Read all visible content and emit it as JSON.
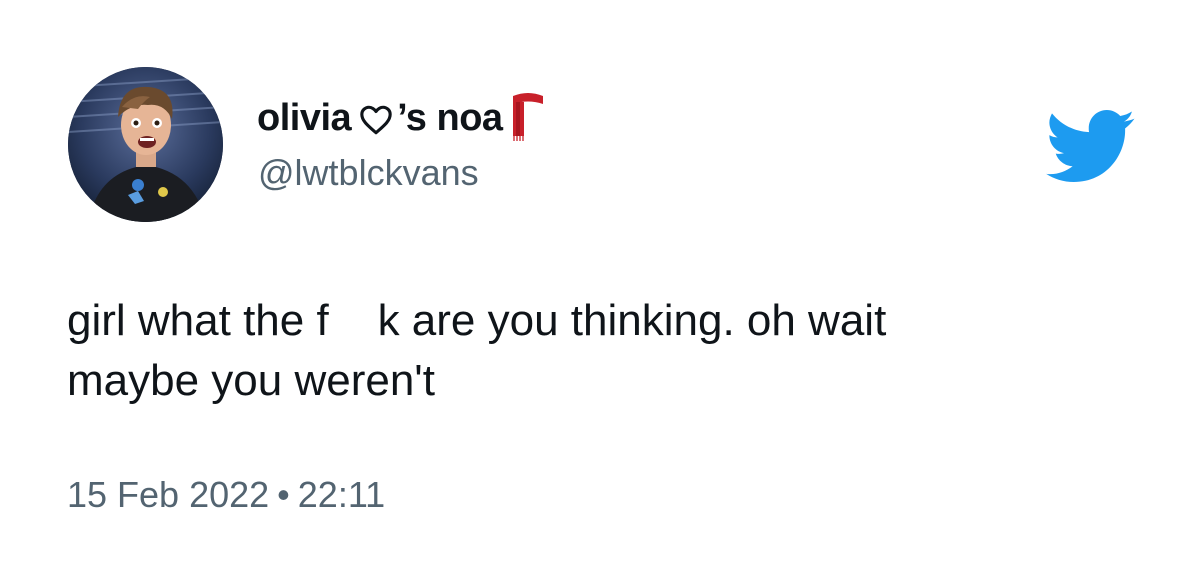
{
  "tweet": {
    "author": {
      "display_name_part1": "olivia",
      "display_name_part2": "’s noa",
      "heart_icon": "heart-outline-icon",
      "scarf_icon": "red-scarf-emoji",
      "handle": "@lwtblckvans",
      "avatar": "profile-photo"
    },
    "brand_icon": "twitter-bird-icon",
    "text": {
      "line1": "girl what the f    k are you thinking. oh wait",
      "line2": "maybe you weren't"
    },
    "timestamp": {
      "date": "15 Feb 2022",
      "separator": "•",
      "time": "22:11"
    },
    "colors": {
      "brand": "#1d9bf0",
      "text": "#0f1419",
      "secondary": "#536471",
      "scarf": "#c8202a"
    }
  }
}
